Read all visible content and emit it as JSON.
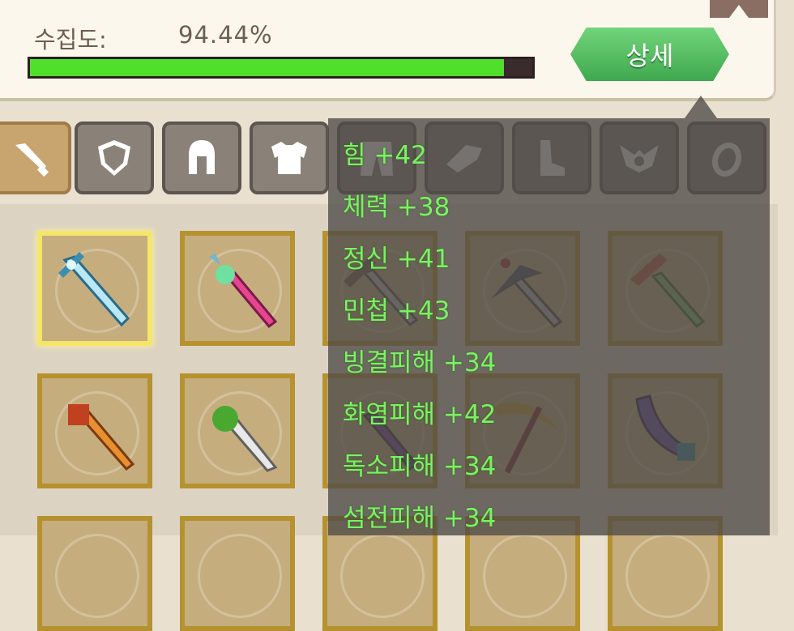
{
  "header": {
    "collection_label": "수집도:",
    "collection_value": "94.44%",
    "collection_progress": 0.944,
    "detail_button": "상세"
  },
  "tabs": [
    {
      "name": "weapon",
      "icon": "sword-icon",
      "active": true
    },
    {
      "name": "shield",
      "icon": "shield-icon",
      "active": false
    },
    {
      "name": "helmet",
      "icon": "helmet-icon",
      "active": false
    },
    {
      "name": "armor",
      "icon": "armor-icon",
      "active": false
    },
    {
      "name": "pants",
      "icon": "pants-icon",
      "active": false
    },
    {
      "name": "gloves",
      "icon": "gloves-icon",
      "active": false
    },
    {
      "name": "boots",
      "icon": "boots-icon",
      "active": false
    },
    {
      "name": "wings",
      "icon": "wings-icon",
      "active": false
    },
    {
      "name": "ring",
      "icon": "ring-icon",
      "active": false
    }
  ],
  "items": [
    {
      "icon": "ice-sword-icon",
      "selected": true,
      "colors": [
        "#3a8fb0",
        "#b8e8f5"
      ]
    },
    {
      "icon": "pink-sword-icon",
      "selected": false,
      "colors": [
        "#e8458f",
        "#6fe0a0"
      ]
    },
    {
      "icon": "dark-sword-icon",
      "selected": false,
      "colors": [
        "#7a5a4a",
        "#c0c0c0"
      ]
    },
    {
      "icon": "crimson-blade-icon",
      "selected": false,
      "colors": [
        "#4a4f5a",
        "#b8b8b8"
      ]
    },
    {
      "icon": "jade-sword-icon",
      "selected": false,
      "colors": [
        "#6ea050",
        "#c0573e"
      ]
    },
    {
      "icon": "fire-sword-icon",
      "selected": false,
      "colors": [
        "#e89030",
        "#c04020"
      ]
    },
    {
      "icon": "leaf-sword-icon",
      "selected": false,
      "colors": [
        "#4aa830",
        "#e0e0e0"
      ]
    },
    {
      "icon": "void-sword-icon",
      "selected": false,
      "colors": [
        "#7a3aa0",
        "#303030"
      ]
    },
    {
      "icon": "scythe-icon",
      "selected": false,
      "colors": [
        "#d0a030",
        "#802030"
      ]
    },
    {
      "icon": "violet-blade-icon",
      "selected": false,
      "colors": [
        "#6a4ab0",
        "#3a8a9a"
      ]
    }
  ],
  "tooltip": {
    "stats": [
      "힘 +42",
      "체력 +38",
      "정신 +41",
      "민첩 +43",
      "빙결피해 +34",
      "화염피해 +42",
      "독소피해 +34",
      "섬전피해 +34"
    ]
  },
  "colors": {
    "progress_fill": "#4fe02c",
    "stat_text": "#7df066",
    "button_green": "#4fb45c"
  }
}
